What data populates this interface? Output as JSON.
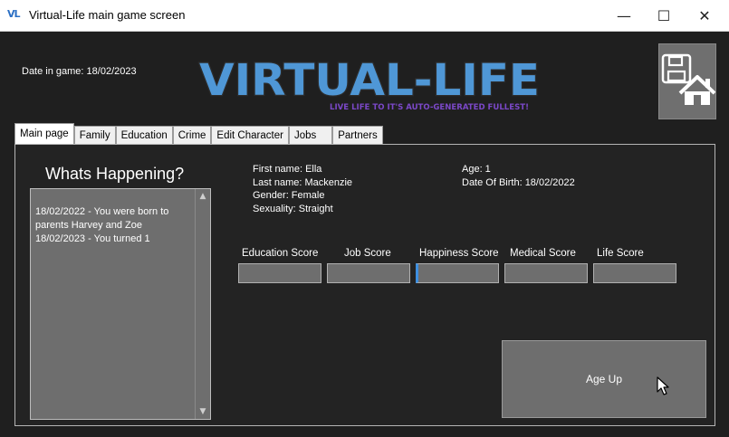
{
  "window": {
    "icon_text": "VL",
    "title": "Virtual-Life main game screen",
    "minimize_glyph": "—",
    "maximize_glyph": "☐",
    "close_glyph": "✕"
  },
  "header": {
    "date_label": "Date in game: 18/02/2023",
    "logo_title": "VIRTUAL-LIFE",
    "logo_tagline": "LIVE LIFE TO IT'S AUTO-GENERATED FULLEST!",
    "save_home_icon": "save-home-icon"
  },
  "tabs": [
    {
      "label": "Main page",
      "active": true
    },
    {
      "label": "Family"
    },
    {
      "label": "Education"
    },
    {
      "label": "Crime"
    },
    {
      "label": "Edit Character"
    },
    {
      "label": "Jobs"
    },
    {
      "label": "Partners"
    }
  ],
  "main": {
    "whats_happening_title": "Whats Happening?",
    "events": [
      "18/02/2022 - You were born to parents Harvey and Zoe",
      "18/02/2023 - You turned 1"
    ],
    "character": {
      "first_name": "First name: Ella",
      "last_name": "Last name: Mackenzie",
      "gender": "Gender: Female",
      "sexuality": "Sexuality: Straight",
      "age": "Age: 1",
      "dob": "Date Of Birth: 18/02/2022"
    },
    "scores": [
      {
        "label": "Education Score"
      },
      {
        "label": "Job Score"
      },
      {
        "label": "Happiness Score"
      },
      {
        "label": "Medical Score"
      },
      {
        "label": "Life Score"
      }
    ],
    "age_up_label": "Age Up"
  },
  "colors": {
    "background": "#1f1f1f",
    "panel_gray": "#6e6e6e",
    "logo_blue": "#4f97d6",
    "tagline_purple": "#7b48c8"
  }
}
